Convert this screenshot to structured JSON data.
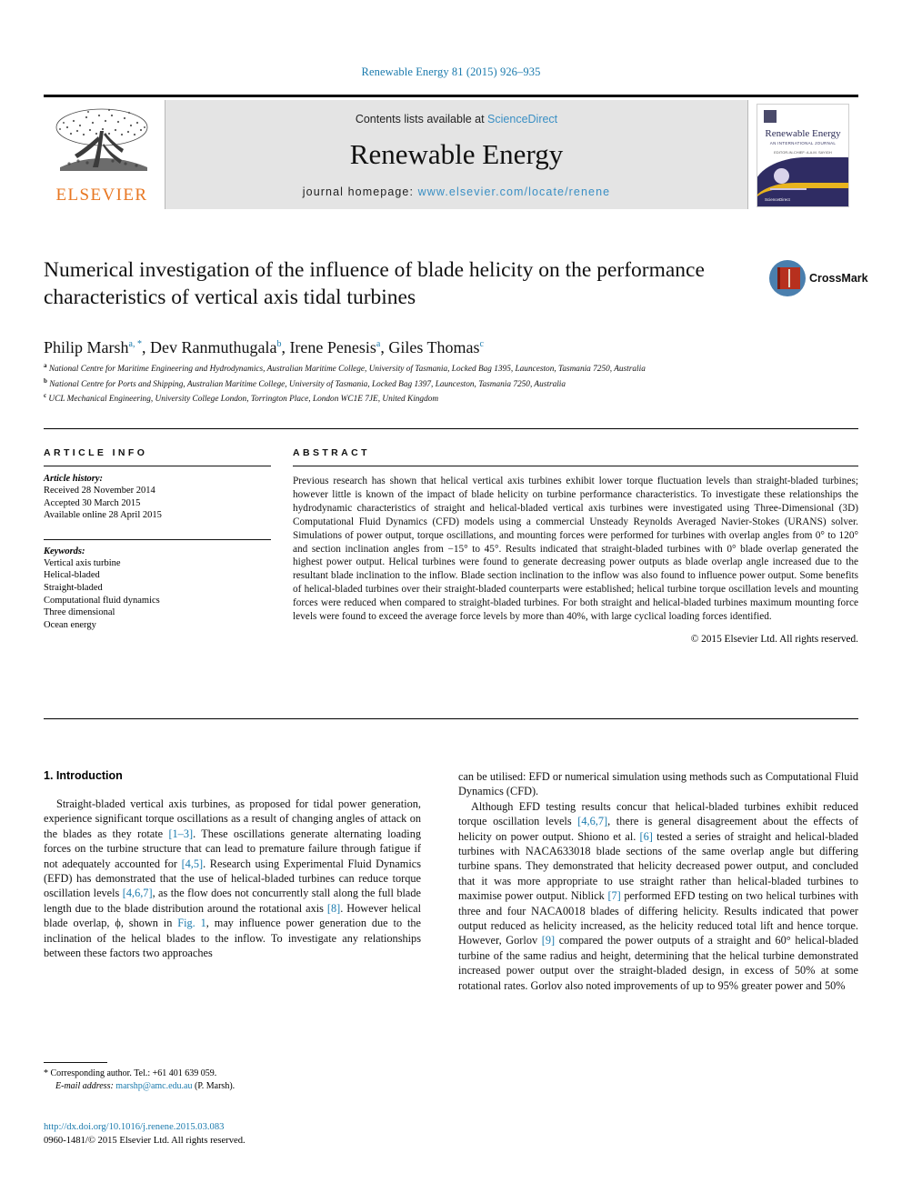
{
  "running_head": "Renewable Energy 81 (2015) 926–935",
  "masthead": {
    "publisher_name": "ELSEVIER",
    "contents_prefix": "Contents lists available at ",
    "contents_link": "ScienceDirect",
    "journal_title": "Renewable Energy",
    "homepage_prefix": "journal homepage: ",
    "homepage_url": "www.elsevier.com/locate/renene",
    "cover": {
      "title": "Renewable Energy",
      "subtitle": "AN INTERNATIONAL JOURNAL",
      "subtitle2": "EDITOR-IN-CHIEF: A.A.M. SAYIGH",
      "footer": "ScienceDirect"
    }
  },
  "crossmark": {
    "label": "CrossMark"
  },
  "article": {
    "title": "Numerical investigation of the influence of blade helicity on the performance characteristics of vertical axis tidal turbines",
    "authors": [
      {
        "name": "Philip Marsh",
        "sup": "a, *"
      },
      {
        "name": "Dev Ranmuthugala",
        "sup": "b"
      },
      {
        "name": "Irene Penesis",
        "sup": "a"
      },
      {
        "name": "Giles Thomas",
        "sup": "c"
      }
    ],
    "affiliations": [
      {
        "marker": "a",
        "text": "National Centre for Maritime Engineering and Hydrodynamics, Australian Maritime College, University of Tasmania, Locked Bag 1395, Launceston, Tasmania 7250, Australia"
      },
      {
        "marker": "b",
        "text": "National Centre for Ports and Shipping, Australian Maritime College, University of Tasmania, Locked Bag 1397, Launceston, Tasmania 7250, Australia"
      },
      {
        "marker": "c",
        "text": "UCL Mechanical Engineering, University College London, Torrington Place, London WC1E 7JE, United Kingdom"
      }
    ]
  },
  "article_info": {
    "heading": "ARTICLE INFO",
    "history_label": "Article history:",
    "history": [
      "Received 28 November 2014",
      "Accepted 30 March 2015",
      "Available online 28 April 2015"
    ],
    "keywords_label": "Keywords:",
    "keywords": [
      "Vertical axis turbine",
      "Helical-bladed",
      "Straight-bladed",
      "Computational fluid dynamics",
      "Three dimensional",
      "Ocean energy"
    ]
  },
  "abstract": {
    "heading": "ABSTRACT",
    "text": "Previous research has shown that helical vertical axis turbines exhibit lower torque fluctuation levels than straight-bladed turbines; however little is known of the impact of blade helicity on turbine performance characteristics. To investigate these relationships the hydrodynamic characteristics of straight and helical-bladed vertical axis turbines were investigated using Three-Dimensional (3D) Computational Fluid Dynamics (CFD) models using a commercial Unsteady Reynolds Averaged Navier-Stokes (URANS) solver. Simulations of power output, torque oscillations, and mounting forces were performed for turbines with overlap angles from 0° to 120° and section inclination angles from −15° to 45°. Results indicated that straight-bladed turbines with 0° blade overlap generated the highest power output. Helical turbines were found to generate decreasing power outputs as blade overlap angle increased due to the resultant blade inclination to the inflow. Blade section inclination to the inflow was also found to influence power output. Some benefits of helical-bladed turbines over their straight-bladed counterparts were established; helical turbine torque oscillation levels and mounting forces were reduced when compared to straight-bladed turbines. For both straight and helical-bladed turbines maximum mounting force levels were found to exceed the average force levels by more than 40%, with large cyclical loading forces identified.",
    "copyright": "© 2015 Elsevier Ltd. All rights reserved."
  },
  "body": {
    "section_heading": "1. Introduction",
    "left_paragraphs": [
      "Straight-bladed vertical axis turbines, as proposed for tidal power generation, experience significant torque oscillations as a result of changing angles of attack on the blades as they rotate [1–3]. These oscillations generate alternating loading forces on the turbine structure that can lead to premature failure through fatigue if not adequately accounted for [4,5]. Research using Experimental Fluid Dynamics (EFD) has demonstrated that the use of helical-bladed turbines can reduce torque oscillation levels [4,6,7], as the flow does not concurrently stall along the full blade length due to the blade distribution around the rotational axis [8]. However helical blade overlap, ϕ, shown in Fig. 1, may influence power generation due to the inclination of the helical blades to the inflow. To investigate any relationships between these factors two approaches"
    ],
    "right_paragraphs": [
      "can be utilised: EFD or numerical simulation using methods such as Computational Fluid Dynamics (CFD).",
      "Although EFD testing results concur that helical-bladed turbines exhibit reduced torque oscillation levels [4,6,7], there is general disagreement about the effects of helicity on power output. Shiono et al. [6] tested a series of straight and helical-bladed turbines with NACA633018 blade sections of the same overlap angle but differing turbine spans. They demonstrated that helicity decreased power output, and concluded that it was more appropriate to use straight rather than helical-bladed turbines to maximise power output. Niblick [7] performed EFD testing on two helical turbines with three and four NACA0018 blades of differing helicity. Results indicated that power output reduced as helicity increased, as the helicity reduced total lift and hence torque. However, Gorlov [9] compared the power outputs of a straight and 60° helical-bladed turbine of the same radius and height, determining that the helical turbine demonstrated increased power output over the straight-bladed design, in excess of 50% at some rotational rates. Gorlov also noted improvements of up to 95% greater power and 50%"
    ]
  },
  "footnote": {
    "corresponding": "* Corresponding author. Tel.: +61 401 639 059.",
    "email_label": "E-mail address:",
    "email": "marshp@amc.edu.au",
    "email_suffix": " (P. Marsh)."
  },
  "doi": {
    "url": "http://dx.doi.org/10.1016/j.renene.2015.03.083",
    "issn_line": "0960-1481/© 2015 Elsevier Ltd. All rights reserved."
  },
  "colors": {
    "link": "#1a7aad",
    "elsevier_orange": "#e87722",
    "band": "#e4e4e4"
  }
}
